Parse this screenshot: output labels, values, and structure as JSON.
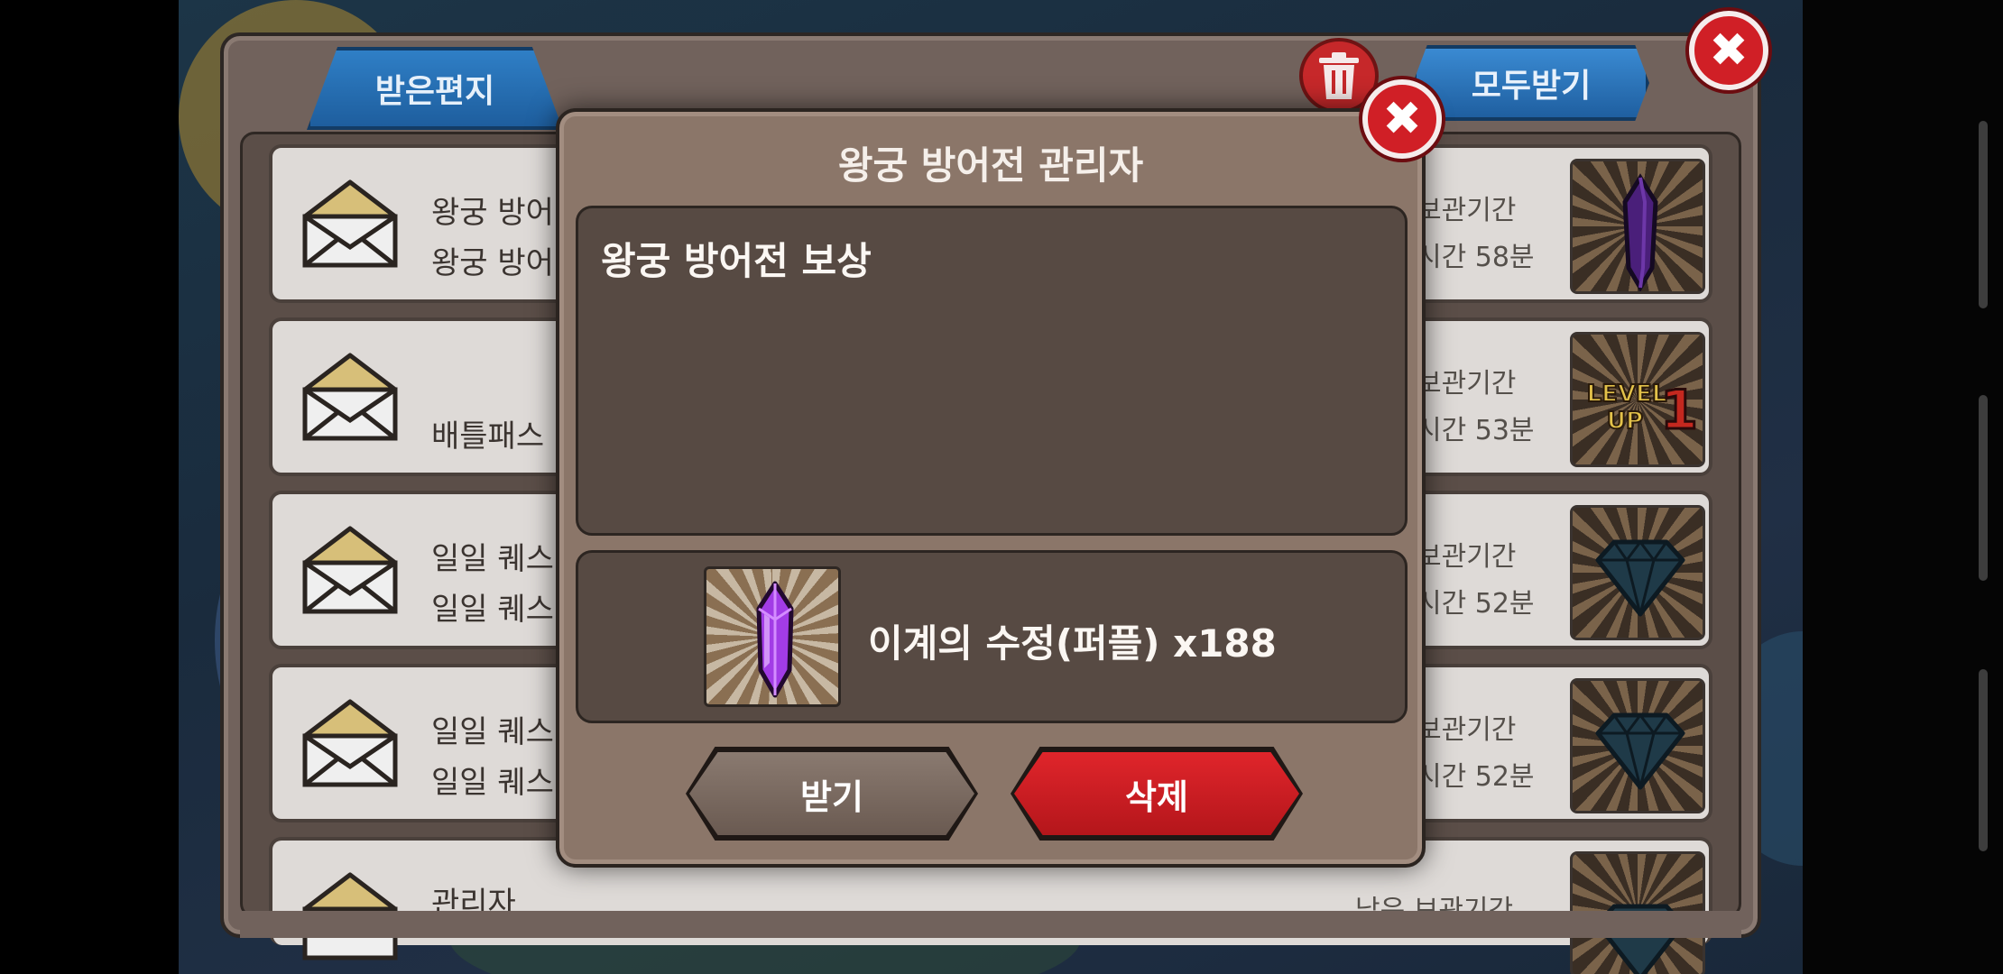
{
  "mailbox": {
    "tab_label": "받은편지",
    "claim_all_label": "모두받기",
    "rows": [
      {
        "line1": "왕궁 방어",
        "line2": "왕궁 방어",
        "keep1": "보관기간",
        "keep2": "시간 58분",
        "reward_icon": "purple-crystal-icon"
      },
      {
        "line1": "",
        "line2": "배틀패스",
        "keep1": "보관기간",
        "keep2": "시간 53분",
        "reward_icon": "level-up-icon"
      },
      {
        "line1": "일일 퀘스",
        "line2": "일일 퀘스",
        "keep1": "보관기간",
        "keep2": "시간 52분",
        "reward_icon": "diamond-icon"
      },
      {
        "line1": "일일 퀘스",
        "line2": "일일 퀘스",
        "keep1": "보관기간",
        "keep2": "시간 52분",
        "reward_icon": "diamond-icon"
      },
      {
        "line1": "관리자",
        "line2": "",
        "keep1": "남은 보관기간",
        "keep2": "",
        "reward_icon": "diamond-icon"
      }
    ],
    "level_up_text": {
      "top": "LEVEL",
      "bottom": "UP",
      "number": "1"
    }
  },
  "modal": {
    "title": "왕궁 방어전 관리자",
    "message": "왕궁 방어전 보상",
    "reward_text": "이계의 수정(퍼플) x188",
    "reward_icon": "purple-crystal-icon",
    "receive_label": "받기",
    "delete_label": "삭제"
  },
  "colors": {
    "accent_blue": "#2f7fc6",
    "delete_red": "#d01f26",
    "crystal_purple": "#a23ce6"
  }
}
